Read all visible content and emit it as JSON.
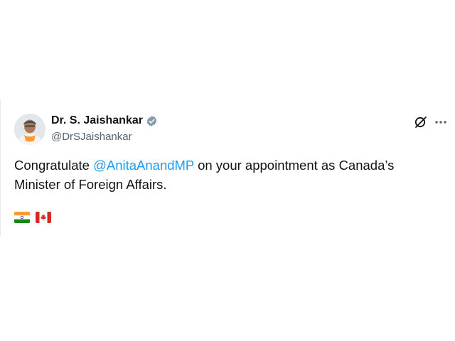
{
  "post": {
    "author": {
      "display_name": "Dr. S. Jaishankar",
      "handle": "@DrSJaishankar",
      "verified": true,
      "verified_color": "#829aab"
    },
    "text_before": "Congratulate ",
    "mention": "@AnitaAnandMP",
    "text_after": " on your appointment as Canada’s Minister of Foreign Affairs.",
    "flags": [
      "india-flag",
      "canada-flag"
    ],
    "link_color": "#1d9bf0",
    "icons": {
      "grok": "grok-icon",
      "more": "more-icon"
    }
  }
}
